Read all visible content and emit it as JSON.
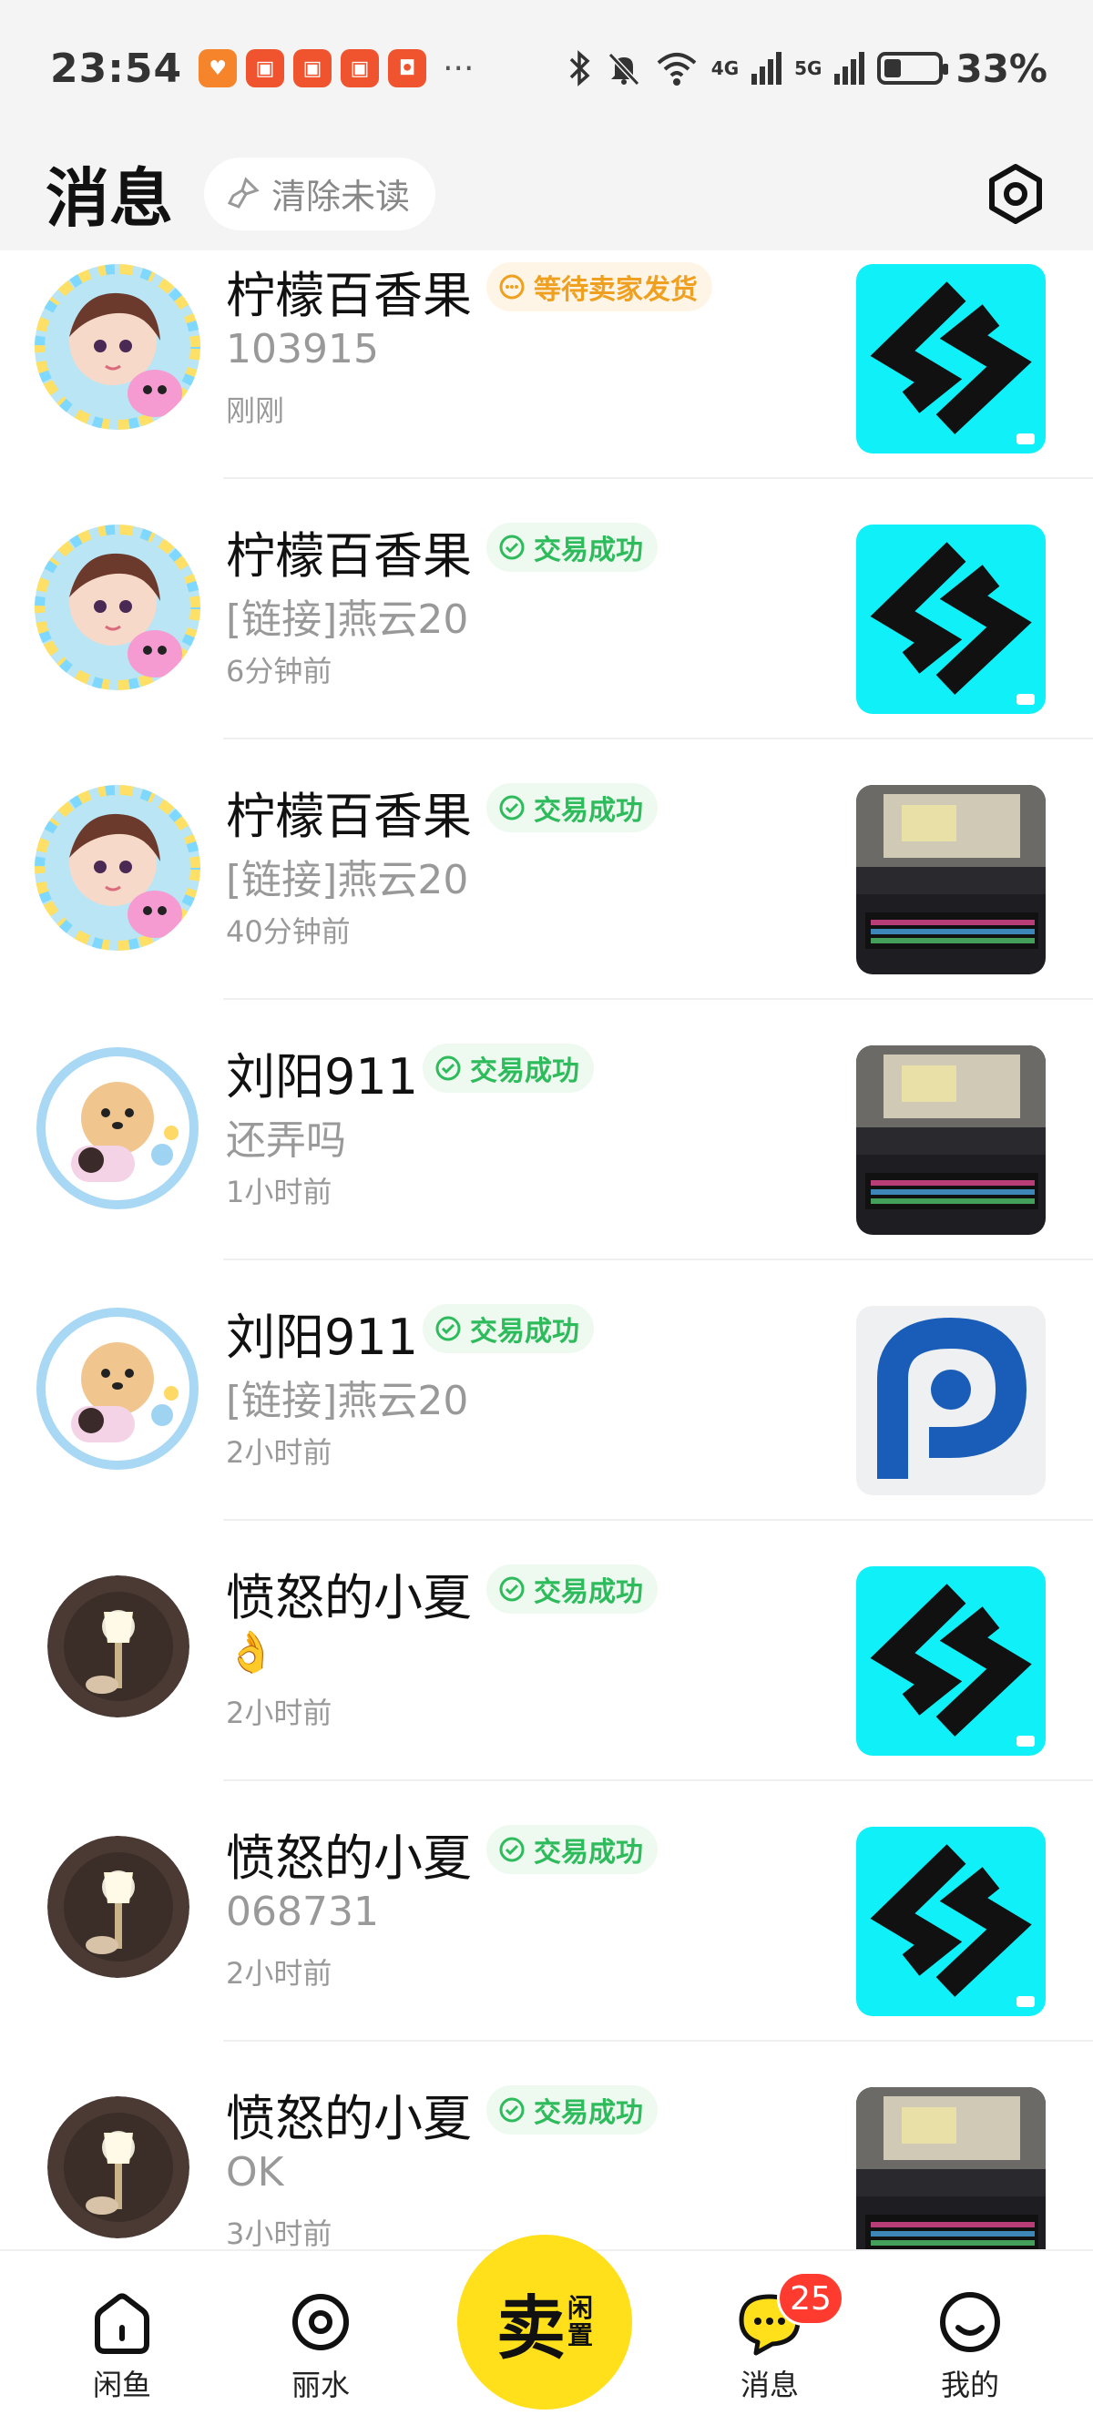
{
  "status_bar": {
    "time": "23:54",
    "network_1": "4G",
    "network_2": "5G",
    "battery_percent_text": "33%",
    "battery_level": 0.33,
    "icons": [
      "bluetooth-icon",
      "mute-icon",
      "wifi-icon"
    ]
  },
  "header": {
    "title": "消息",
    "clear_unread_label": "清除未读"
  },
  "conversations": [
    {
      "name": "柠檬百香果",
      "status": "等待卖家发货",
      "status_type": "pending",
      "preview": "103915",
      "time": "刚刚",
      "avatar": "anime-girl",
      "thumb": "s-logo"
    },
    {
      "name": "柠檬百香果",
      "status": "交易成功",
      "status_type": "success",
      "preview": "[链接]燕云20",
      "time": "6分钟前",
      "avatar": "anime-girl",
      "thumb": "s-logo"
    },
    {
      "name": "柠檬百香果",
      "status": "交易成功",
      "status_type": "success",
      "preview": "[链接]燕云20",
      "time": "40分钟前",
      "avatar": "anime-girl",
      "thumb": "desk-photo"
    },
    {
      "name": "刘阳911",
      "status": "交易成功",
      "status_type": "success",
      "preview": "还弄吗",
      "time": "1小时前",
      "avatar": "dog-sticker",
      "thumb": "desk-photo"
    },
    {
      "name": "刘阳911",
      "status": "交易成功",
      "status_type": "success",
      "preview": "[链接]燕云20",
      "time": "2小时前",
      "avatar": "dog-sticker",
      "thumb": "p-logo"
    },
    {
      "name": "愤怒的小夏",
      "status": "交易成功",
      "status_type": "success",
      "preview": "👌",
      "time": "2小时前",
      "avatar": "dark-lamp",
      "thumb": "s-logo"
    },
    {
      "name": "愤怒的小夏",
      "status": "交易成功",
      "status_type": "success",
      "preview": "068731",
      "time": "2小时前",
      "avatar": "dark-lamp",
      "thumb": "s-logo"
    },
    {
      "name": "愤怒的小夏",
      "status": "交易成功",
      "status_type": "success",
      "preview": "OK",
      "time": "3小时前",
      "avatar": "dark-lamp",
      "thumb": "desk-photo"
    }
  ],
  "bottom_nav": {
    "items": [
      {
        "label": "闲鱼",
        "icon": "home-icon"
      },
      {
        "label": "丽水",
        "icon": "location-icon"
      },
      {
        "label": "消息",
        "icon": "chat-icon"
      },
      {
        "label": "我的",
        "icon": "profile-icon"
      }
    ],
    "sell_main": "卖",
    "sell_sub_1": "闲",
    "sell_sub_2": "置",
    "message_badge": "25"
  },
  "colors": {
    "accent_yellow": "#ffe01b",
    "success_green": "#2dbb5c",
    "pending_orange": "#f0a020",
    "badge_red": "#ff3b30"
  }
}
